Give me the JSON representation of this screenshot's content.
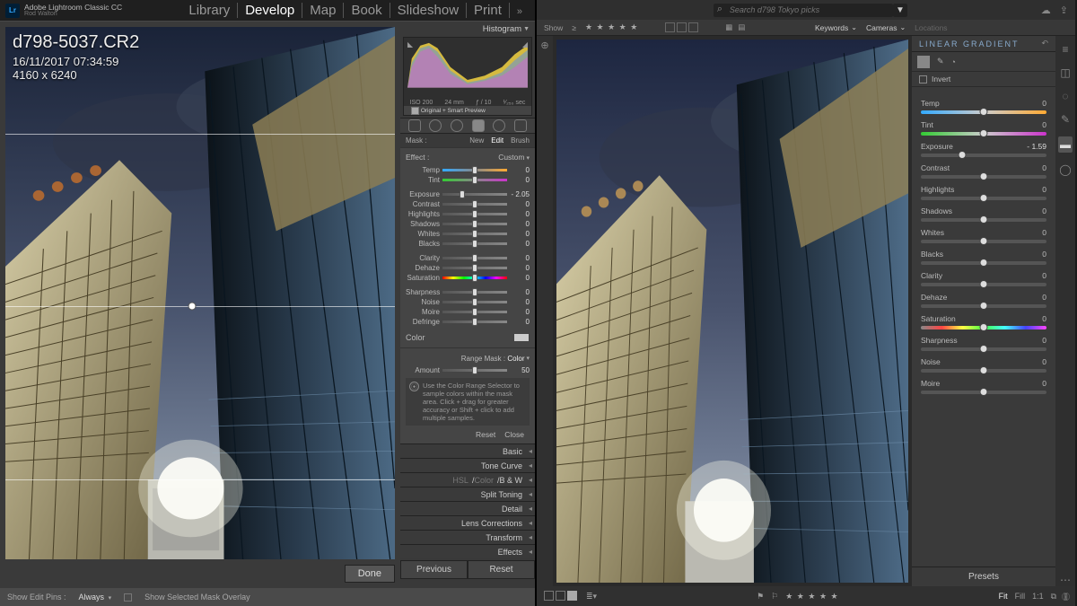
{
  "left": {
    "brand_app": "Adobe Lightroom Classic CC",
    "brand_user": "Rod Walton",
    "logo": "Lr",
    "modules": [
      "Library",
      "Develop",
      "Map",
      "Book",
      "Slideshow",
      "Print"
    ],
    "active_module": "Develop",
    "chevron": "»",
    "overlay": {
      "filename": "d798-5037.CR2",
      "datetime": "16/11/2017 07:34:59",
      "dims": "4160 x 6240"
    },
    "bottom": {
      "pins_label": "Show Edit Pins :",
      "pins_mode": "Always",
      "mask_label": "Show Selected Mask Overlay",
      "done": "Done"
    },
    "panel": {
      "histogram_label": "Histogram",
      "histo_meta": {
        "iso": "ISO 200",
        "focal": "24 mm",
        "ap": "ƒ / 10",
        "shutter": "¹⁄₂₅₀ sec"
      },
      "histo_strip": "Original + Smart Preview",
      "mask_label": "Mask :",
      "mask_new": "New",
      "mask_edit": "Edit",
      "mask_brush": "Brush",
      "effect_label": "Effect :",
      "effect_value": "Custom",
      "sliders": {
        "temp": {
          "label": "Temp",
          "val": "0",
          "pos": 50,
          "cls": "temp"
        },
        "tint": {
          "label": "Tint",
          "val": "0",
          "pos": 50,
          "cls": "tint"
        },
        "exposure": {
          "label": "Exposure",
          "val": "- 2.05",
          "pos": 30
        },
        "contrast": {
          "label": "Contrast",
          "val": "0",
          "pos": 50
        },
        "highlights": {
          "label": "Highlights",
          "val": "0",
          "pos": 50
        },
        "shadows": {
          "label": "Shadows",
          "val": "0",
          "pos": 50
        },
        "whites": {
          "label": "Whites",
          "val": "0",
          "pos": 50
        },
        "blacks": {
          "label": "Blacks",
          "val": "0",
          "pos": 50
        },
        "clarity": {
          "label": "Clarity",
          "val": "0",
          "pos": 50
        },
        "dehaze": {
          "label": "Dehaze",
          "val": "0",
          "pos": 50
        },
        "saturation": {
          "label": "Saturation",
          "val": "0",
          "pos": 50,
          "cls": "rainbow"
        },
        "sharpness": {
          "label": "Sharpness",
          "val": "0",
          "pos": 50
        },
        "noise": {
          "label": "Noise",
          "val": "0",
          "pos": 50
        },
        "moire": {
          "label": "Moire",
          "val": "0",
          "pos": 50
        },
        "defringe": {
          "label": "Defringe",
          "val": "0",
          "pos": 50
        }
      },
      "color_label": "Color",
      "range_mask_label": "Range Mask :",
      "range_mask_value": "Color",
      "amount_label": "Amount",
      "amount_val": "50",
      "tip": "Use the Color Range Selector to sample colors within the mask area. Click + drag for greater accuracy or Shift + click to add multiple samples.",
      "reset": "Reset",
      "close": "Close",
      "sections": {
        "basic": "Basic",
        "tone": "Tone Curve",
        "hsl_pre": "HSL",
        "hsl_mid": "Color",
        "hsl_post": "B & W",
        "split": "Split Toning",
        "detail": "Detail",
        "lens": "Lens Corrections",
        "transform": "Transform",
        "effects": "Effects"
      },
      "previous": "Previous",
      "reset_btn": "Reset"
    }
  },
  "right": {
    "search_placeholder": "Search d798 Tokyo picks",
    "filter_bar": {
      "show": "Show",
      "gte": "≥",
      "keywords": "Keywords",
      "cameras": "Cameras",
      "locations": "Locations"
    },
    "panel": {
      "title": "LINEAR GRADIENT",
      "invert": "Invert",
      "sliders": {
        "temp": {
          "label": "Temp",
          "val": "0",
          "pos": 50,
          "cls": "temp"
        },
        "tint": {
          "label": "Tint",
          "val": "0",
          "pos": 50,
          "cls": "tint"
        },
        "exposure": {
          "label": "Exposure",
          "val": "- 1.59",
          "pos": 33
        },
        "contrast": {
          "label": "Contrast",
          "val": "0",
          "pos": 50
        },
        "highlights": {
          "label": "Highlights",
          "val": "0",
          "pos": 50
        },
        "shadows": {
          "label": "Shadows",
          "val": "0",
          "pos": 50
        },
        "whites": {
          "label": "Whites",
          "val": "0",
          "pos": 50
        },
        "blacks": {
          "label": "Blacks",
          "val": "0",
          "pos": 50
        },
        "clarity": {
          "label": "Clarity",
          "val": "0",
          "pos": 50
        },
        "dehaze": {
          "label": "Dehaze",
          "val": "0",
          "pos": 50
        },
        "saturation": {
          "label": "Saturation",
          "val": "0",
          "pos": 50,
          "cls": "sat"
        },
        "sharpness": {
          "label": "Sharpness",
          "val": "0",
          "pos": 50
        },
        "noise": {
          "label": "Noise",
          "val": "0",
          "pos": 50
        },
        "moire": {
          "label": "Moire",
          "val": "0",
          "pos": 50
        }
      },
      "presets": "Presets"
    },
    "bottom": {
      "fit": "Fit",
      "fill": "Fill",
      "one": "1:1"
    }
  }
}
